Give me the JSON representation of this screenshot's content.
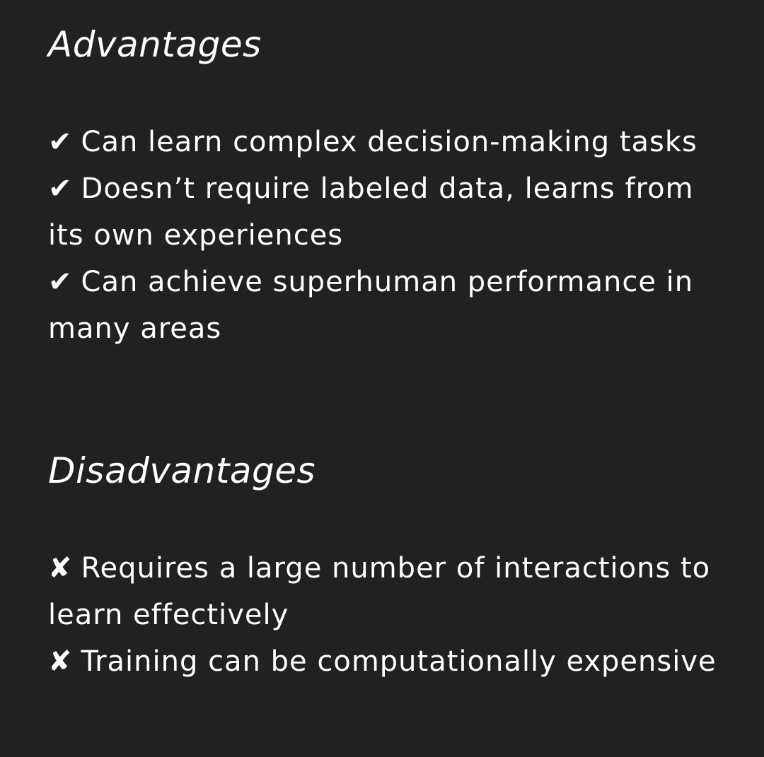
{
  "advantages": {
    "heading": "Advantages",
    "items": [
      {
        "mark": "✔",
        "mark_icon": "check-icon",
        "text": "Can learn complex decision-making tasks"
      },
      {
        "mark": "✔",
        "mark_icon": "check-icon",
        "text": "Doesn’t require labeled data, learns from its own experiences"
      },
      {
        "mark": "✔",
        "mark_icon": "check-icon",
        "text": "Can achieve superhuman performance in many areas"
      }
    ]
  },
  "disadvantages": {
    "heading": "Disadvantages",
    "items": [
      {
        "mark": "✘",
        "mark_icon": "cross-icon",
        "text": "Requires a large number of interactions to learn effectively"
      },
      {
        "mark": "✘",
        "mark_icon": "cross-icon",
        "text": "Training can be computationally expensive"
      }
    ]
  }
}
